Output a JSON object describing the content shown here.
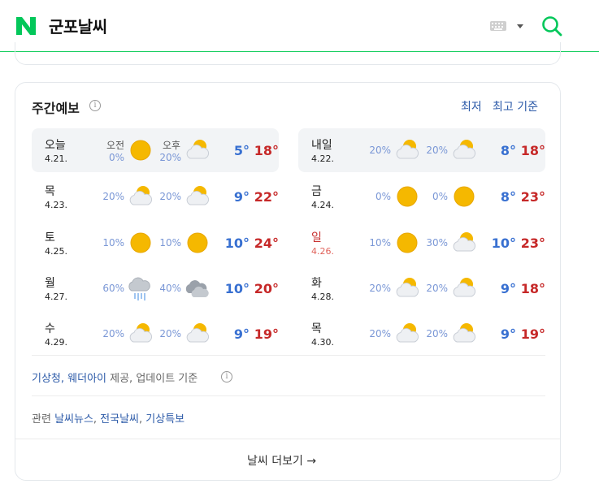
{
  "header": {
    "logo_letter": "N",
    "query": "군포날씨",
    "brand_color": "#03c75a"
  },
  "weekly": {
    "title": "주간예보",
    "sort_low": "최저",
    "sort_high": "최고 기준",
    "am_label": "오전",
    "pm_label": "오후",
    "days": [
      {
        "day": "오늘",
        "date": "4.21.",
        "am_pct": "0%",
        "am_icon": "sun-icon",
        "pm_pct": "20%",
        "pm_icon": "partly-cloudy-icon",
        "low": "5°",
        "high": "18°"
      },
      {
        "day": "내일",
        "date": "4.22.",
        "am_pct": "20%",
        "am_icon": "partly-cloudy-icon",
        "pm_pct": "20%",
        "pm_icon": "partly-cloudy-icon",
        "low": "8°",
        "high": "18°"
      },
      {
        "day": "목",
        "date": "4.23.",
        "am_pct": "20%",
        "am_icon": "partly-cloudy-icon",
        "pm_pct": "20%",
        "pm_icon": "partly-cloudy-icon",
        "low": "9°",
        "high": "22°"
      },
      {
        "day": "금",
        "date": "4.24.",
        "am_pct": "0%",
        "am_icon": "sun-icon",
        "pm_pct": "0%",
        "pm_icon": "sun-icon",
        "low": "8°",
        "high": "23°"
      },
      {
        "day": "토",
        "date": "4.25.",
        "am_pct": "10%",
        "am_icon": "sun-icon",
        "pm_pct": "10%",
        "pm_icon": "sun-icon",
        "low": "10°",
        "high": "24°"
      },
      {
        "day": "일",
        "date": "4.26.",
        "am_pct": "10%",
        "am_icon": "sun-icon",
        "pm_pct": "30%",
        "pm_icon": "partly-cloudy-icon",
        "low": "10°",
        "high": "23°"
      },
      {
        "day": "월",
        "date": "4.27.",
        "am_pct": "60%",
        "am_icon": "rain-icon",
        "pm_pct": "40%",
        "pm_icon": "cloudy-icon",
        "low": "10°",
        "high": "20°"
      },
      {
        "day": "화",
        "date": "4.28.",
        "am_pct": "20%",
        "am_icon": "partly-cloudy-icon",
        "pm_pct": "20%",
        "pm_icon": "partly-cloudy-icon",
        "low": "9°",
        "high": "18°"
      },
      {
        "day": "수",
        "date": "4.29.",
        "am_pct": "20%",
        "am_icon": "partly-cloudy-icon",
        "pm_pct": "20%",
        "pm_icon": "partly-cloudy-icon",
        "low": "9°",
        "high": "19°"
      },
      {
        "day": "목",
        "date": "4.30.",
        "am_pct": "20%",
        "am_icon": "partly-cloudy-icon",
        "pm_pct": "20%",
        "pm_icon": "partly-cloudy-icon",
        "low": "9°",
        "high": "19°"
      }
    ]
  },
  "footer": {
    "source_kma": "기상청",
    "source_sep": ", ",
    "source_wd": "웨더아이",
    "source_rest": " 제공, 업데이트 기준",
    "related_label": "관련",
    "related_links": [
      "날씨뉴스",
      "전국날씨",
      "기상특보"
    ],
    "more_label": "날씨 더보기",
    "more_arrow": "→"
  },
  "colors": {
    "low_temp": "#3870d1",
    "high_temp": "#c62828",
    "link": "#2c5aa8",
    "sun": "#f5b800"
  }
}
